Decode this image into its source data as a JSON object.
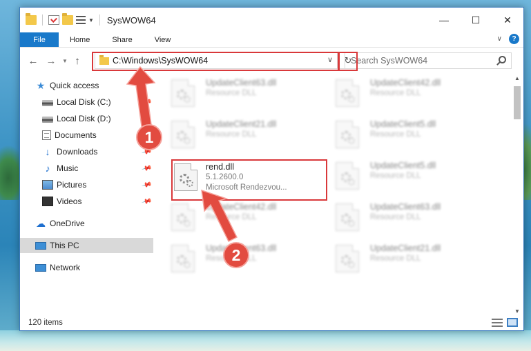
{
  "window": {
    "title": "SysWOW64",
    "controls": {
      "minimize": "—",
      "maximize": "☐",
      "close": "✕"
    }
  },
  "ribbon": {
    "file_tab": "File",
    "tabs": [
      "Home",
      "Share",
      "View"
    ]
  },
  "address": {
    "path": "C:\\Windows\\SysWOW64",
    "search_placeholder": "Search SysWOW64"
  },
  "sidebar": {
    "items": [
      {
        "label": "Quick access",
        "icon": "star-icon",
        "pinned": false
      },
      {
        "label": "Local Disk (C:)",
        "icon": "drive-icon",
        "pinned": true
      },
      {
        "label": "Local Disk (D:)",
        "icon": "drive-icon",
        "pinned": false
      },
      {
        "label": "Documents",
        "icon": "documents-icon",
        "pinned": false
      },
      {
        "label": "Downloads",
        "icon": "download-icon",
        "pinned": true
      },
      {
        "label": "Music",
        "icon": "music-icon",
        "pinned": true
      },
      {
        "label": "Pictures",
        "icon": "pictures-icon",
        "pinned": true
      },
      {
        "label": "Videos",
        "icon": "videos-icon",
        "pinned": true
      },
      {
        "label": "OneDrive",
        "icon": "onedrive-icon"
      },
      {
        "label": "This PC",
        "icon": "pc-icon",
        "selected": true
      },
      {
        "label": "Network",
        "icon": "network-icon"
      }
    ]
  },
  "files": [
    {
      "name": "UpdateClient63.dll",
      "sub": "Resource DLL",
      "blurred": true
    },
    {
      "name": "UpdateClient42.dll",
      "sub": "Resource DLL",
      "blurred": true
    },
    {
      "name": "UpdateClient21.dll",
      "sub": "Resource DLL",
      "blurred": true
    },
    {
      "name": "UpdateClient5.dll",
      "sub": "Resource DLL",
      "blurred": true
    },
    {
      "name": "rend.dll",
      "version": "5.1.2600.0",
      "sub": "Microsoft Rendezvou...",
      "blurred": false
    },
    {
      "name": "UpdateClient5.dll",
      "sub": "Resource DLL",
      "blurred": true
    },
    {
      "name": "UpdateClient42.dll",
      "sub": "Resource DLL",
      "blurred": true
    },
    {
      "name": "UpdateClient63.dll",
      "sub": "Resource DLL",
      "blurred": true
    },
    {
      "name": "UpdateClient63.dll",
      "sub": "Resource DLL",
      "blurred": true
    },
    {
      "name": "UpdateClient21.dll",
      "sub": "Resource DLL",
      "blurred": true
    }
  ],
  "status": {
    "count": "120 items"
  },
  "annotations": {
    "step1": "1",
    "step2": "2",
    "color": "#e24b40"
  }
}
